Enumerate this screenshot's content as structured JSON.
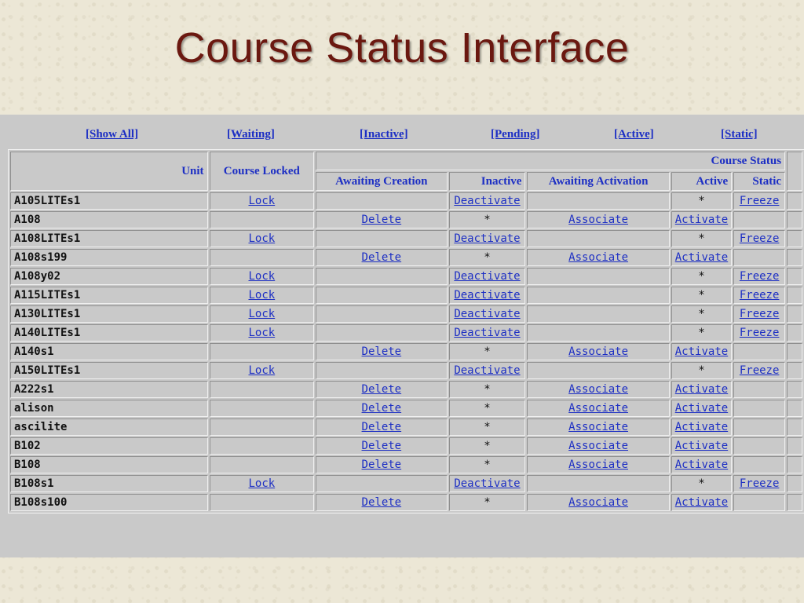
{
  "slide_title": "Course Status Interface",
  "filters": [
    "[Show All]",
    "[Waiting]",
    "[Inactive]",
    "[Pending]",
    "[Active]",
    "[Static]"
  ],
  "headers": {
    "unit": "Unit",
    "course_locked": "Course Locked",
    "course_status": "Course Status",
    "awaiting_creation": "Awaiting Creation",
    "inactive": "Inactive",
    "awaiting_activation": "Awaiting Activation",
    "active": "Active",
    "static": "Static"
  },
  "rows": [
    {
      "unit": "A105LITEs1",
      "lock": "Lock",
      "create": "",
      "inactive": "Deactivate",
      "await": "",
      "active": "*",
      "static": "Freeze"
    },
    {
      "unit": "A108",
      "lock": "",
      "create": "Delete",
      "inactive": "*",
      "await": "Associate",
      "active": "Activate",
      "static": ""
    },
    {
      "unit": "A108LITEs1",
      "lock": "Lock",
      "create": "",
      "inactive": "Deactivate",
      "await": "",
      "active": "*",
      "static": "Freeze"
    },
    {
      "unit": "A108s199",
      "lock": "",
      "create": "Delete",
      "inactive": "*",
      "await": "Associate",
      "active": "Activate",
      "static": ""
    },
    {
      "unit": "A108y02",
      "lock": "Lock",
      "create": "",
      "inactive": "Deactivate",
      "await": "",
      "active": "*",
      "static": "Freeze"
    },
    {
      "unit": "A115LITEs1",
      "lock": "Lock",
      "create": "",
      "inactive": "Deactivate",
      "await": "",
      "active": "*",
      "static": "Freeze"
    },
    {
      "unit": "A130LITEs1",
      "lock": "Lock",
      "create": "",
      "inactive": "Deactivate",
      "await": "",
      "active": "*",
      "static": "Freeze"
    },
    {
      "unit": "A140LITEs1",
      "lock": "Lock",
      "create": "",
      "inactive": "Deactivate",
      "await": "",
      "active": "*",
      "static": "Freeze"
    },
    {
      "unit": "A140s1",
      "lock": "",
      "create": "Delete",
      "inactive": "*",
      "await": "Associate",
      "active": "Activate",
      "static": ""
    },
    {
      "unit": "A150LITEs1",
      "lock": "Lock",
      "create": "",
      "inactive": "Deactivate",
      "await": "",
      "active": "*",
      "static": "Freeze"
    },
    {
      "unit": "A222s1",
      "lock": "",
      "create": "Delete",
      "inactive": "*",
      "await": "Associate",
      "active": "Activate",
      "static": ""
    },
    {
      "unit": "alison",
      "lock": "",
      "create": "Delete",
      "inactive": "*",
      "await": "Associate",
      "active": "Activate",
      "static": ""
    },
    {
      "unit": "ascilite",
      "lock": "",
      "create": "Delete",
      "inactive": "*",
      "await": "Associate",
      "active": "Activate",
      "static": ""
    },
    {
      "unit": "B102",
      "lock": "",
      "create": "Delete",
      "inactive": "*",
      "await": "Associate",
      "active": "Activate",
      "static": ""
    },
    {
      "unit": "B108",
      "lock": "",
      "create": "Delete",
      "inactive": "*",
      "await": "Associate",
      "active": "Activate",
      "static": ""
    },
    {
      "unit": "B108s1",
      "lock": "Lock",
      "create": "",
      "inactive": "Deactivate",
      "await": "",
      "active": "*",
      "static": "Freeze"
    },
    {
      "unit": "B108s100",
      "lock": "",
      "create": "Delete",
      "inactive": "*",
      "await": "Associate",
      "active": "Activate",
      "static": ""
    }
  ]
}
